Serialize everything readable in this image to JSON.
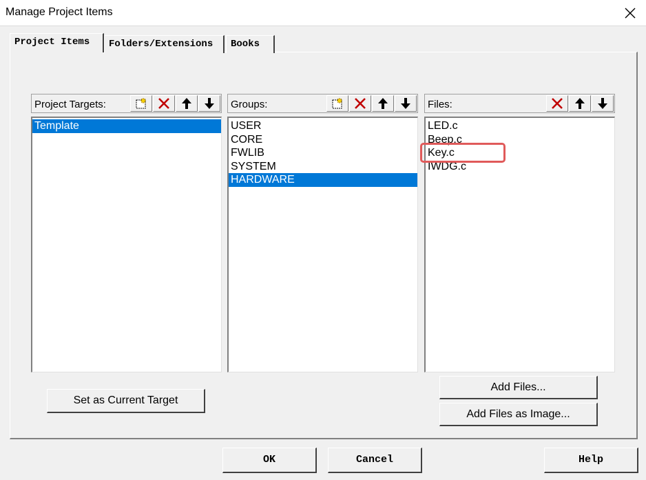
{
  "window": {
    "title": "Manage Project Items"
  },
  "tabs": [
    {
      "label": "Project Items",
      "active": true
    },
    {
      "label": "Folders/Extensions",
      "active": false
    },
    {
      "label": "Books",
      "active": false
    }
  ],
  "targets": {
    "label": "Project Targets:",
    "items": [
      {
        "label": "Template",
        "selected": true
      }
    ]
  },
  "groups": {
    "label": "Groups:",
    "items": [
      {
        "label": "USER",
        "selected": false
      },
      {
        "label": "CORE",
        "selected": false
      },
      {
        "label": "FWLIB",
        "selected": false
      },
      {
        "label": "SYSTEM",
        "selected": false
      },
      {
        "label": "HARDWARE",
        "selected": true
      }
    ]
  },
  "files": {
    "label": "Files:",
    "items": [
      {
        "label": "LED.c",
        "selected": false
      },
      {
        "label": "Beep.c",
        "selected": false
      },
      {
        "label": "Key.c",
        "selected": false,
        "highlighted": true
      },
      {
        "label": "IWDG.c",
        "selected": false
      }
    ]
  },
  "buttons": {
    "set_current_target": "Set as Current Target",
    "add_files": "Add Files...",
    "add_files_as_image": "Add Files as Image...",
    "ok": "OK",
    "cancel": "Cancel",
    "help": "Help"
  },
  "icons": {
    "new": "new-item-icon",
    "delete": "delete-icon",
    "move_up": "arrow-up-icon",
    "move_down": "arrow-down-icon"
  },
  "colors": {
    "selection": "#0078d7",
    "delete_red": "#c00000",
    "highlight_box": "#e05a5a"
  }
}
